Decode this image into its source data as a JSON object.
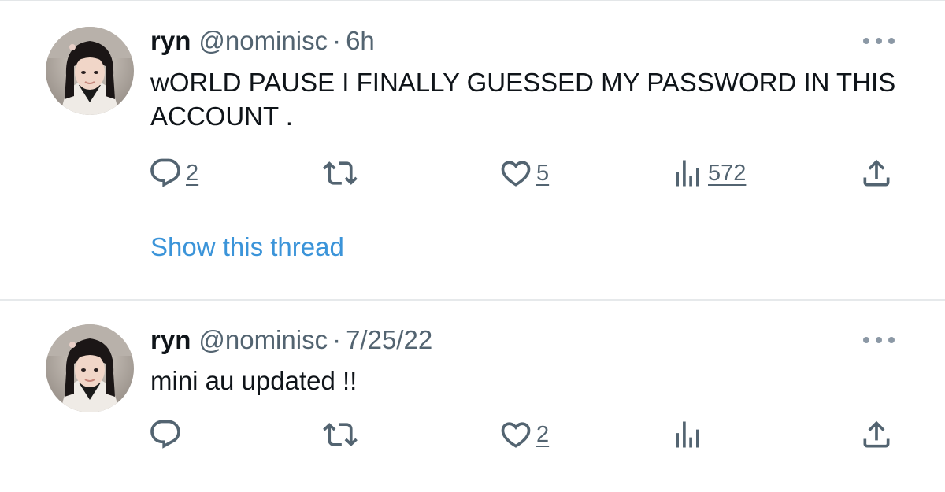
{
  "tweets": [
    {
      "name": "ryn",
      "handle": "@nominisc",
      "separator": "·",
      "time": "6h",
      "text": "wORLD PAUSE I FINALLY GUESSED MY PASSWORD IN THIS ACCOUNT .",
      "reply_count": "2",
      "like_count": "5",
      "view_count": "572",
      "show_thread": "Show this thread"
    },
    {
      "name": "ryn",
      "handle": "@nominisc",
      "separator": "·",
      "time": "7/25/22",
      "text": "mini au updated !!",
      "like_count": "2"
    }
  ],
  "icons": {
    "reply": "reply-icon",
    "retweet": "retweet-icon",
    "like": "heart-icon",
    "views": "views-icon",
    "share": "share-icon",
    "more": "more-icon"
  },
  "colors": {
    "text": "#0f1419",
    "secondary": "#536471",
    "link": "#3b94d9",
    "divider": "#e6e9eb"
  }
}
